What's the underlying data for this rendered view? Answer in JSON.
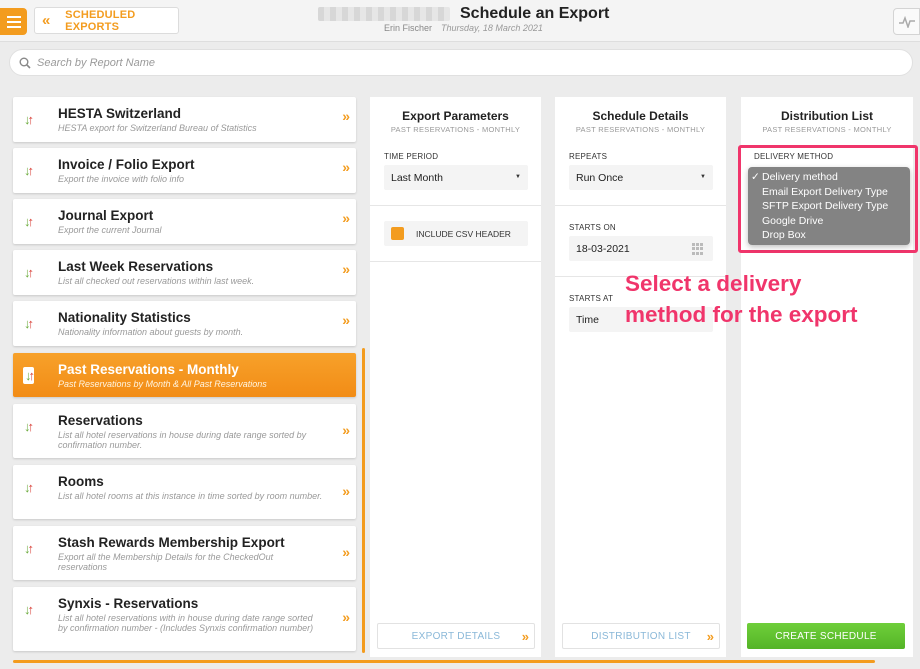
{
  "header": {
    "back_label": "SCHEDULED EXPORTS",
    "title": "Schedule an Export",
    "user": "Erin Fischer",
    "date": "Thursday, 18 March 2021"
  },
  "search": {
    "placeholder": "Search by Report Name"
  },
  "reports": [
    {
      "title": "HESTA Switzerland",
      "description": "HESTA export for Switzerland Bureau of Statistics",
      "selected": false
    },
    {
      "title": "Invoice / Folio Export",
      "description": "Export the invoice with folio info",
      "selected": false
    },
    {
      "title": "Journal Export",
      "description": "Export the current Journal",
      "selected": false
    },
    {
      "title": "Last Week Reservations",
      "description": "List all checked out reservations within last week.",
      "selected": false
    },
    {
      "title": "Nationality Statistics",
      "description": "Nationality information about guests by month.",
      "selected": false
    },
    {
      "title": "Past Reservations - Monthly",
      "description": "Past Reservations by Month & All Past Reservations",
      "selected": true
    },
    {
      "title": "Reservations",
      "description": "List all hotel reservations in house during date range sorted by confirmation number.",
      "selected": false
    },
    {
      "title": "Rooms",
      "description": "List all hotel rooms at this instance in time sorted by room number.",
      "selected": false
    },
    {
      "title": "Stash Rewards Membership Export",
      "description": "Export all the Membership Details for the CheckedOut reservations",
      "selected": false
    },
    {
      "title": "Synxis - Reservations",
      "description": "List all hotel reservations with in house during date range sorted by confirmation number - (Includes Synxis confirmation number)",
      "selected": false
    }
  ],
  "export_params": {
    "title": "Export Parameters",
    "subtitle": "PAST RESERVATIONS - MONTHLY",
    "time_period_label": "TIME PERIOD",
    "time_period_value": "Last Month",
    "csv_header_label": "INCLUDE CSV HEADER",
    "csv_header_checked": true,
    "footer_button": "EXPORT DETAILS"
  },
  "schedule": {
    "title": "Schedule Details",
    "subtitle": "PAST RESERVATIONS - MONTHLY",
    "repeats_label": "REPEATS",
    "repeats_value": "Run Once",
    "starts_on_label": "STARTS ON",
    "starts_on_value": "18-03-2021",
    "starts_at_label": "STARTS AT",
    "starts_at_value": "Time",
    "footer_button": "DISTRIBUTION LIST"
  },
  "distribution": {
    "title": "Distribution List",
    "subtitle": "PAST RESERVATIONS - MONTHLY",
    "delivery_label": "DELIVERY METHOD",
    "delivery_options": [
      "Delivery method",
      "Email Export Delivery Type",
      "SFTP Export Delivery Type",
      "Google Drive",
      "Drop Box"
    ],
    "selected_option": "Delivery method",
    "footer_button": "CREATE SCHEDULE"
  },
  "annotation": {
    "line1": "Select a delivery",
    "line2": "method for the export"
  },
  "colors": {
    "accent": "#f39c1f",
    "create_button": "#5bbd2b",
    "annotation": "#f0356b",
    "link": "#8ab8d8"
  }
}
